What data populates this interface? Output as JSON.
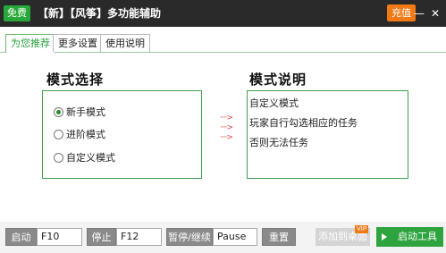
{
  "titlebar": {
    "free_badge": "免费",
    "title": "【新】【风筝】多功能辅助",
    "recharge": "充值",
    "minimize_icon": "minimize-icon",
    "close_icon": "close-icon"
  },
  "tabs": [
    {
      "label": "为您推荐",
      "active": true
    },
    {
      "label": "更多设置",
      "active": false
    },
    {
      "label": "使用说明",
      "active": false
    }
  ],
  "mode_select": {
    "title": "模式选择",
    "options": [
      {
        "label": "新手模式",
        "checked": true
      },
      {
        "label": "进阶模式",
        "checked": false
      },
      {
        "label": "自定义模式",
        "checked": false
      }
    ]
  },
  "arrows": [
    "····>",
    "····>",
    "····>"
  ],
  "mode_desc": {
    "title": "模式说明",
    "lines": [
      "自定义模式",
      "玩家自行勾选相应的任务",
      "否则无法任务"
    ]
  },
  "bottombar": {
    "start_label": "启动",
    "start_key": "F10",
    "stop_label": "停止",
    "stop_key": "F12",
    "pause_label": "暂停/继续",
    "pause_key": "Pause",
    "reset_label": "重置",
    "add_desktop_label": "添加到桌面",
    "vip_badge": "VIP",
    "start_tool_label": "启动工具"
  },
  "colors": {
    "accent_green": "#2ea43f",
    "titlebar_bg": "#2a2a2a",
    "recharge_orange": "#f07a16"
  }
}
